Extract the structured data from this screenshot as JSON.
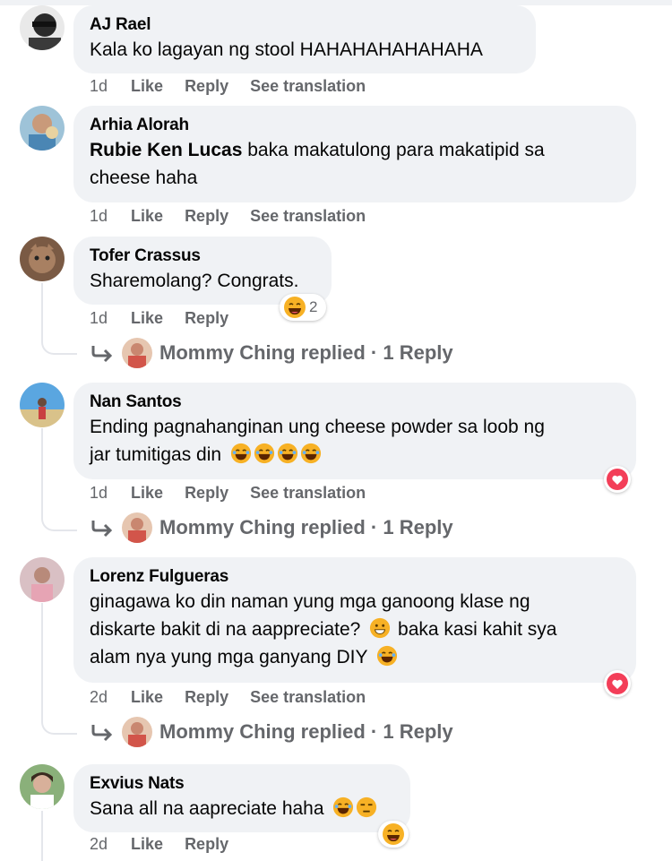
{
  "comments": [
    {
      "author": "AJ Rael",
      "text": "Kala ko lagayan ng stool HAHAHAHAHAHAHA",
      "time": "1d",
      "like": "Like",
      "reply": "Reply",
      "translate": "See translation"
    },
    {
      "author": "Arhia Alorah",
      "mention": "Rubie Ken Lucas",
      "text_line1": " baka makatulong para makatipid sa",
      "text_line2": "cheese haha",
      "time": "1d",
      "like": "Like",
      "reply": "Reply",
      "translate": "See translation"
    },
    {
      "author": "Tofer Crassus",
      "text": "Sharemolang? Congrats.",
      "time": "1d",
      "like": "Like",
      "reply": "Reply",
      "reaction_count": "2",
      "replies_summary": "Mommy Ching replied · 1 Reply"
    },
    {
      "author": "Nan Santos",
      "text_line1": "Ending pagnahanginan ung cheese powder sa loob ng",
      "text_line2": "jar tumitigas din",
      "time": "1d",
      "like": "Like",
      "reply": "Reply",
      "translate": "See translation",
      "replies_summary": "Mommy Ching replied · 1 Reply"
    },
    {
      "author": "Lorenz Fulgueras",
      "text_line1": "ginagawa ko din naman yung mga ganoong klase ng",
      "text_line2a": "diskarte bakit di na aappreciate?",
      "text_line2b": " baka kasi kahit sya",
      "text_line3": "alam nya yung mga ganyang DIY",
      "time": "2d",
      "like": "Like",
      "reply": "Reply",
      "translate": "See translation",
      "replies_summary": "Mommy Ching replied · 1 Reply"
    },
    {
      "author": "Exvius Nats",
      "text": "Sana all na aapreciate haha",
      "time": "2d",
      "like": "Like",
      "reply": "Reply"
    }
  ],
  "colors": {
    "bubble": "#f0f2f5",
    "meta": "#65676b",
    "text": "#050505",
    "heart": "#f33e58",
    "emoji": "#f7b125"
  },
  "icons": [
    "reply-arrow-icon",
    "laughing-emoji-icon",
    "heart-reaction-icon",
    "unamused-emoji-icon"
  ]
}
